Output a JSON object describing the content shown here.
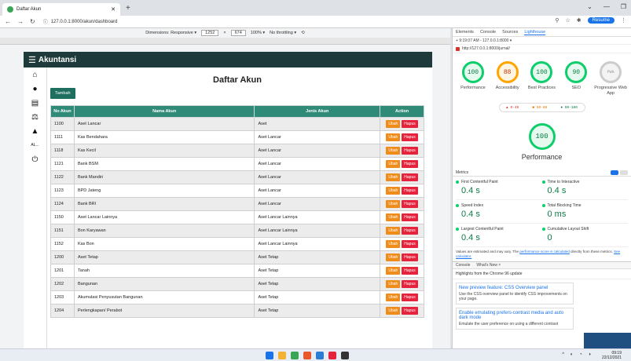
{
  "browser": {
    "tab_title": "Daftar Akun",
    "url": "127.0.0.1:8000/akun/dashboard",
    "resume_label": "Resume"
  },
  "devicebar": {
    "mode": "Dimensions: Responsive ▾",
    "width": "1252",
    "height": "674",
    "zoom": "100% ▾",
    "throttle": "No throttling ▾"
  },
  "app": {
    "brand": "Akuntansi",
    "title": "Daftar Akun",
    "add_label": "Tambah",
    "side_label": "AL..."
  },
  "table": {
    "headers": [
      "No Akun",
      "Nama Akun",
      "Jenis Akun",
      "Action"
    ],
    "ubah": "Ubah",
    "hapus": "Hapus",
    "rows": [
      [
        "1100",
        "Aset Lancar",
        "Aset"
      ],
      [
        "1111",
        "Kas Bendahara",
        "Aset Lancar"
      ],
      [
        "1118",
        "Kas Kecil",
        "Aset Lancar"
      ],
      [
        "1121",
        "Bank BSM",
        "Aset Lancar"
      ],
      [
        "1122",
        "Bank Mandiri",
        "Aset Lancar"
      ],
      [
        "1123",
        "BPD Jateng",
        "Aset Lancar"
      ],
      [
        "1124",
        "Bank BRI",
        "Aset Lancar"
      ],
      [
        "1150",
        "Aset Lancar Lainnya",
        "Aset Lancar Lainnya"
      ],
      [
        "1151",
        "Bon Karyawan",
        "Aset Lancar Lainnya"
      ],
      [
        "1152",
        "Kas Bon",
        "Aset Lancar Lainnya"
      ],
      [
        "1200",
        "Aset Tetap",
        "Aset Tetap"
      ],
      [
        "1201",
        "Tanah",
        "Aset Tetap"
      ],
      [
        "1202",
        "Bangunan",
        "Aset Tetap"
      ],
      [
        "1203",
        "Akumulasi Penyusutan Bangunan",
        "Aset Tetap"
      ],
      [
        "1204",
        "Perlengkapan/ Perabot",
        "Aset Tetap"
      ]
    ]
  },
  "devtools": {
    "tabs": [
      "Elements",
      "Console",
      "Sources",
      "Lighthouse"
    ],
    "report_time": "9:19:07 AM - 127.0.0.1:8000 ▾",
    "report_url": "http://127.0.0.1:8000/jurnal/",
    "gauges": [
      {
        "score": "100",
        "label": "Performance",
        "color": "#0cce6b",
        "bg": "#e6f9ef",
        "fg": "#0a7c44"
      },
      {
        "score": "88",
        "label": "Accessibility",
        "color": "#ffa400",
        "bg": "#fff5e5",
        "fg": "#c33300"
      },
      {
        "score": "100",
        "label": "Best Practices",
        "color": "#0cce6b",
        "bg": "#e6f9ef",
        "fg": "#0a7c44"
      },
      {
        "score": "90",
        "label": "SEO",
        "color": "#0cce6b",
        "bg": "#e6f9ef",
        "fg": "#0a7c44"
      },
      {
        "score": "PWA",
        "label": "Progressive Web App",
        "color": "#cccccc",
        "bg": "#f3f3f3",
        "fg": "#999999"
      }
    ],
    "legend": [
      "▲ 0-49",
      "■ 50-89",
      "● 90-100"
    ],
    "main_score": "100",
    "main_label": "Performance",
    "metrics_label": "Metrics",
    "metrics": [
      {
        "name": "First Contentful Paint",
        "value": "0.4 s"
      },
      {
        "name": "Time to Interactive",
        "value": "0.4 s"
      },
      {
        "name": "Speed Index",
        "value": "0.4 s"
      },
      {
        "name": "Total Blocking Time",
        "value": "0 ms"
      },
      {
        "name": "Largest Contentful Paint",
        "value": "0.4 s"
      },
      {
        "name": "Cumulative Layout Shift",
        "value": "0"
      }
    ],
    "note": "Values are estimated and may vary. The",
    "note_link": "performance score is calculated",
    "note_end": "directly from these metrics.",
    "see_calc": "See calculator.",
    "console_tabs": [
      "Console",
      "What's New ×"
    ],
    "highlights": "Highlights from the Chrome 96 update",
    "news": [
      {
        "title": "New preview feature: CSS Overview panel",
        "desc": "Use the CSS overview panel to identify CSS improvements on your page."
      },
      {
        "title": "Enable emulating prefers-contrast media and auto dark mode",
        "desc": "Emulate the user preference on using a different contrast"
      }
    ]
  },
  "taskbar": {
    "time": "09:19",
    "date": "22/12/2021"
  }
}
